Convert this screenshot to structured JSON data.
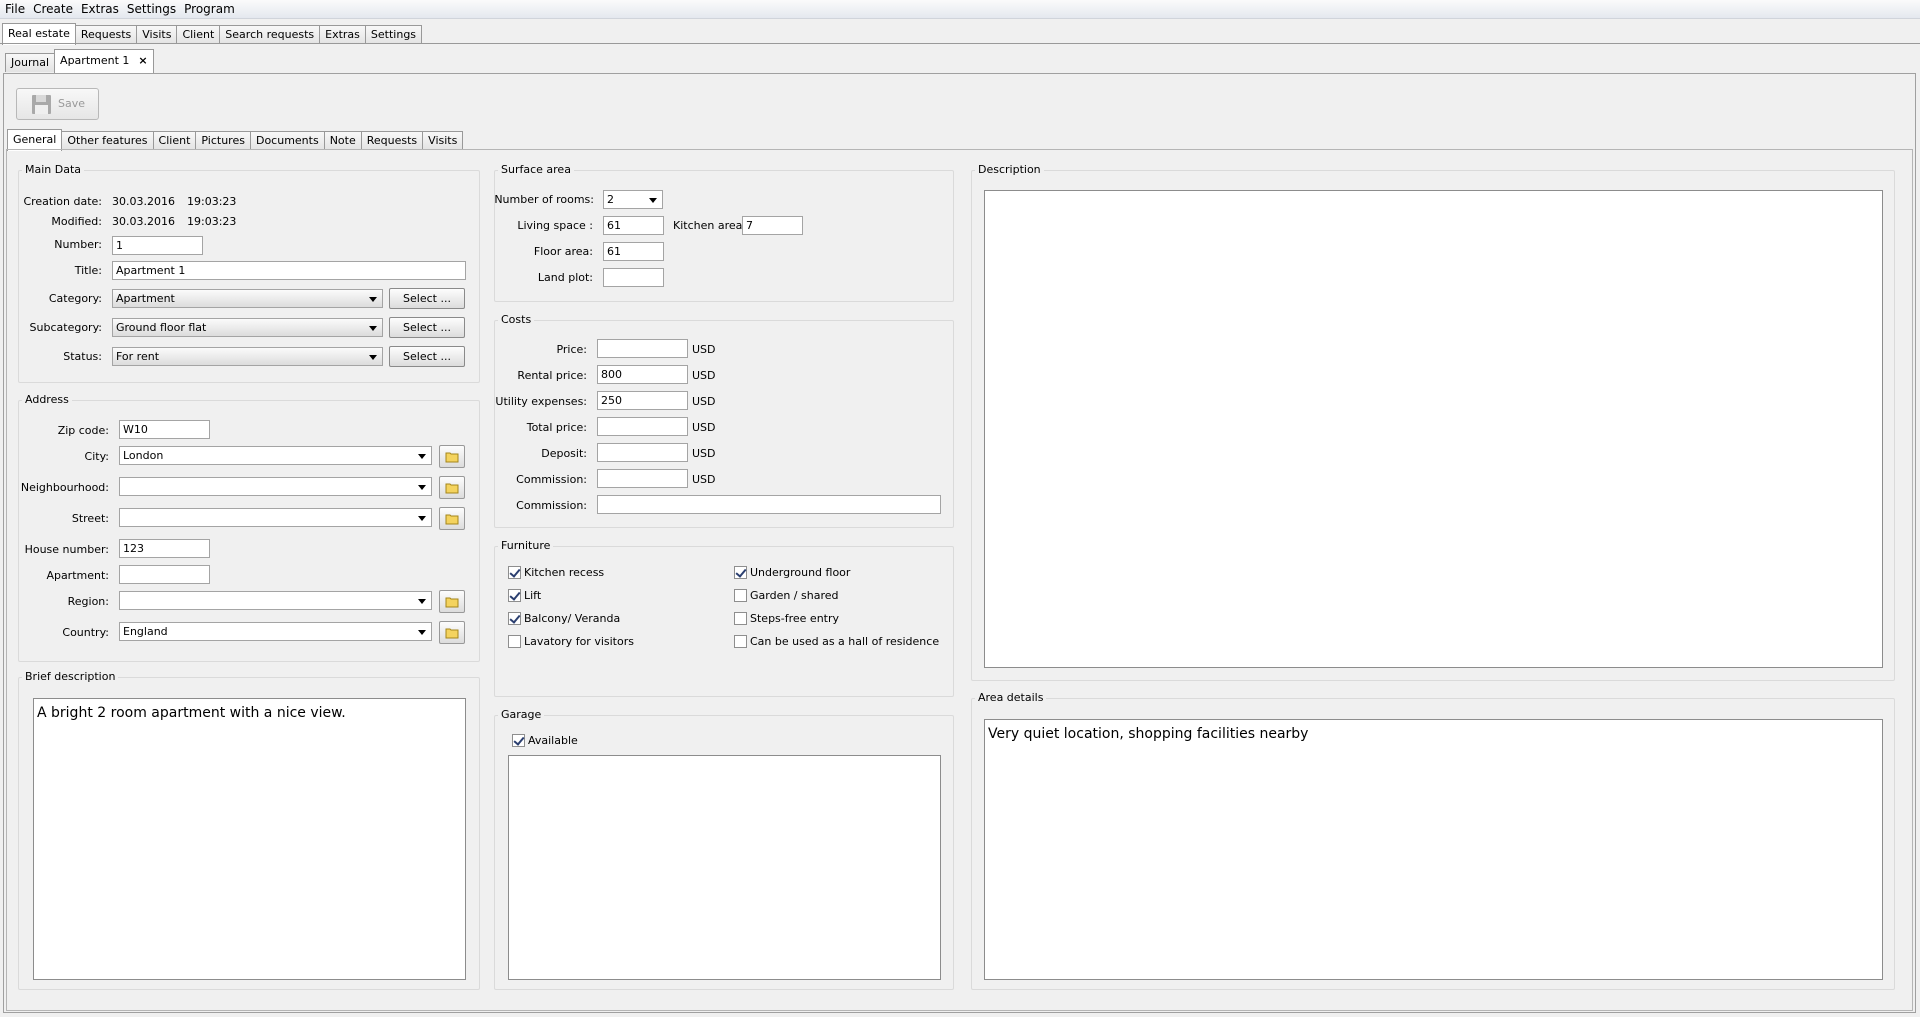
{
  "menu": [
    "File",
    "Create",
    "Extras",
    "Settings",
    "Program"
  ],
  "main_tabs": [
    "Real estate",
    "Requests",
    "Visits",
    "Client",
    "Search requests",
    "Extras",
    "Settings"
  ],
  "doc_tabs": {
    "journal": "Journal",
    "apartment": "Apartment 1",
    "close": "×"
  },
  "toolbar": {
    "save_label": "Save"
  },
  "inner_tabs": [
    "General",
    "Other features",
    "Client",
    "Pictures",
    "Documents",
    "Note",
    "Requests",
    "Visits"
  ],
  "main_data": {
    "title": "Main Data",
    "creation_label": "Creation date:",
    "creation_date": "30.03.2016",
    "creation_time": "19:03:23",
    "modified_label": "Modified:",
    "modified_date": "30.03.2016",
    "modified_time": "19:03:23",
    "number_label": "Number:",
    "number": "1",
    "title_label": "Title:",
    "title_value": "Apartment 1",
    "category_label": "Category:",
    "category": "Apartment",
    "subcategory_label": "Subcategory:",
    "subcategory": "Ground floor flat",
    "status_label": "Status:",
    "status": "For rent",
    "select_label": "Select ..."
  },
  "address": {
    "title": "Address",
    "zip_label": "Zip code:",
    "zip": "W10",
    "city_label": "City:",
    "city": "London",
    "neighbourhood_label": "Neighbourhood:",
    "neighbourhood": "",
    "street_label": "Street:",
    "street": "",
    "house_label": "House number:",
    "house": "123",
    "apartment_label": "Apartment:",
    "apartment": "",
    "region_label": "Region:",
    "region": "",
    "country_label": "Country:",
    "country": "England"
  },
  "brief": {
    "title": "Brief description",
    "text": "A bright 2 room apartment with a nice view."
  },
  "surface": {
    "title": "Surface area",
    "rooms_label": "Number of rooms:",
    "rooms": "2",
    "living_label": "Living space :",
    "living": "61",
    "kitchen_label": "Kitchen area:",
    "kitchen": "7",
    "floor_label": "Floor area:",
    "floor": "61",
    "land_label": "Land plot:",
    "land": ""
  },
  "costs": {
    "title": "Costs",
    "currency": "USD",
    "price_label": "Price:",
    "price": "",
    "rental_label": "Rental price:",
    "rental": "800",
    "utility_label": "Utility expenses:",
    "utility": "250",
    "total_label": "Total price:",
    "total": "",
    "deposit_label": "Deposit:",
    "deposit": "",
    "commission_label": "Commission:",
    "commission": "",
    "commission2_label": "Commission:",
    "commission2": ""
  },
  "furniture": {
    "title": "Furniture",
    "items": [
      {
        "label": "Kitchen recess",
        "checked": true
      },
      {
        "label": "Lift",
        "checked": true
      },
      {
        "label": "Balcony/ Veranda",
        "checked": true
      },
      {
        "label": "Lavatory for visitors",
        "checked": false
      },
      {
        "label": "Underground floor",
        "checked": true
      },
      {
        "label": "Garden / shared",
        "checked": false
      },
      {
        "label": "Steps-free entry",
        "checked": false
      },
      {
        "label": "Can be used as a hall of residence",
        "checked": false
      }
    ]
  },
  "garage": {
    "title": "Garage",
    "available_label": "Available",
    "available": true,
    "text": ""
  },
  "description": {
    "title": "Description",
    "text": ""
  },
  "area_details": {
    "title": "Area details",
    "text": "Very quiet location, shopping facilities nearby"
  }
}
